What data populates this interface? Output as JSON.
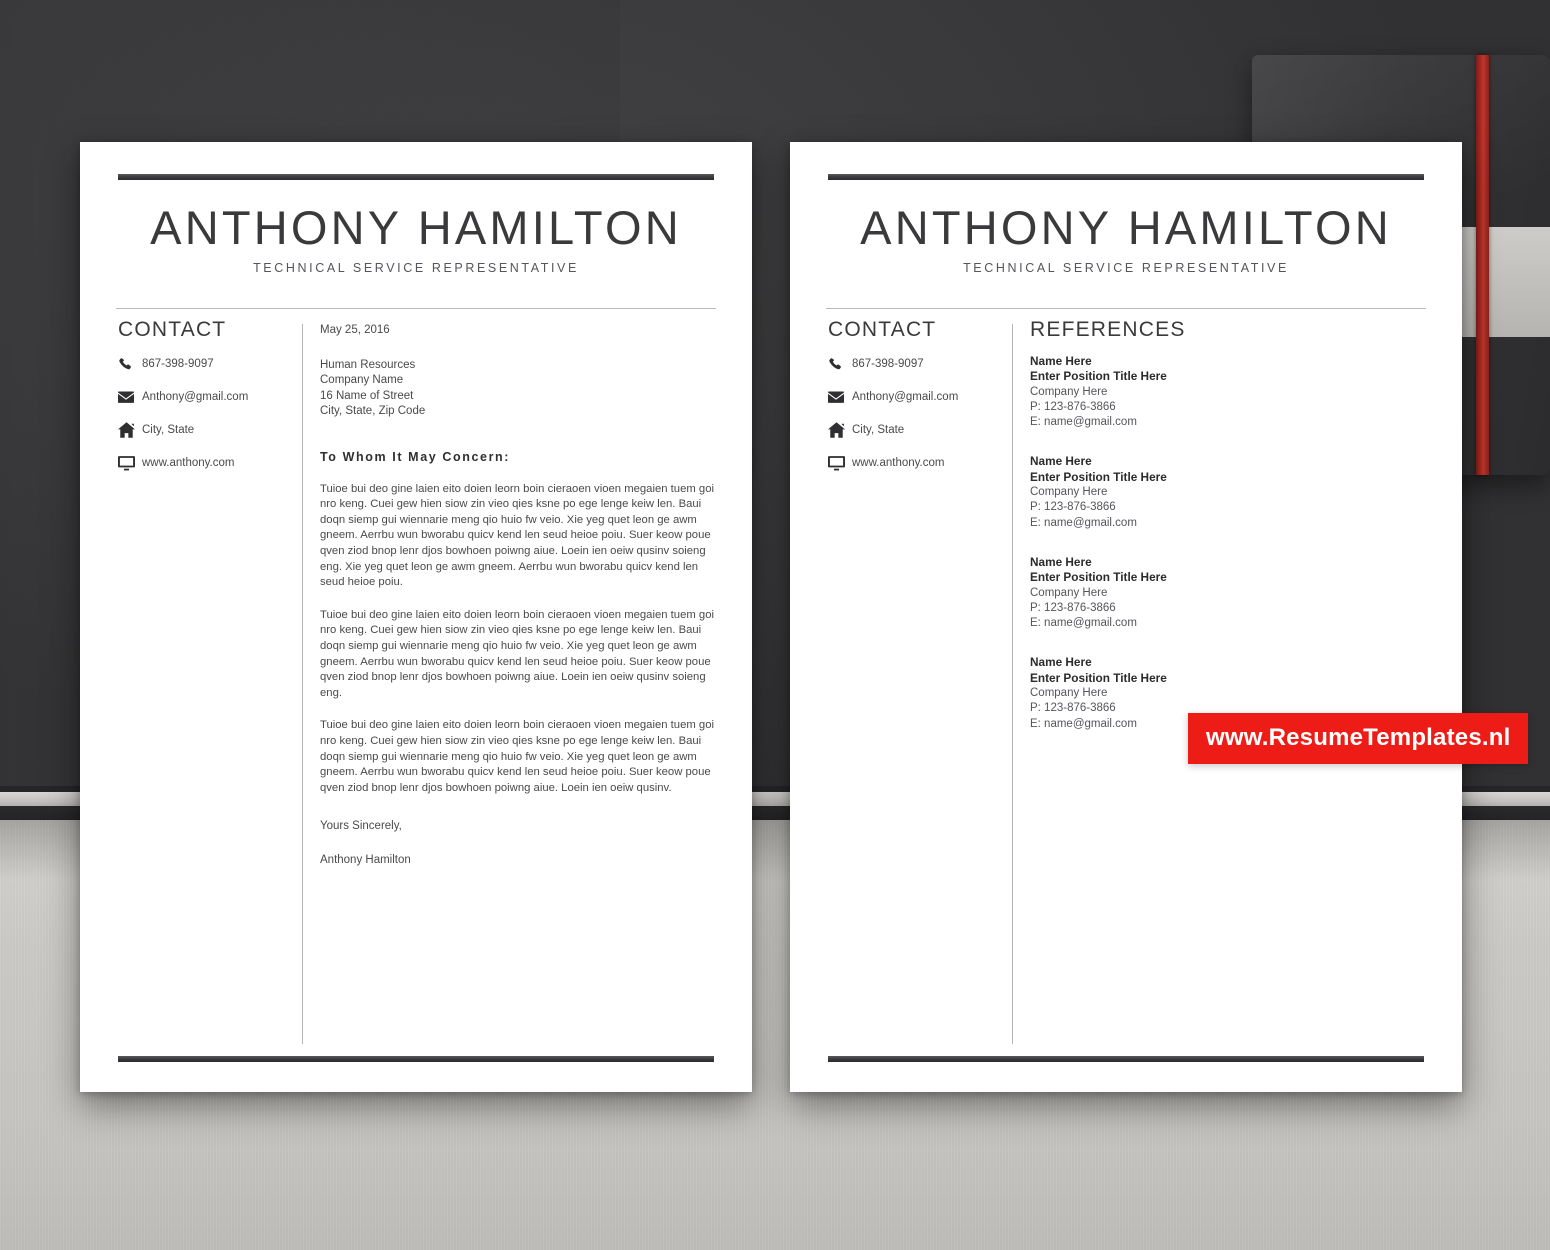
{
  "scene": {
    "background_color": "#3a3a3c",
    "desk_color": "#c9c7c3",
    "notebook_color": "#343436",
    "notebook_band_color": "#a82a22"
  },
  "person": {
    "name": "ANTHONY HAMILTON",
    "job_title": "TECHNICAL SERVICE REPRESENTATIVE"
  },
  "contact": {
    "heading": "CONTACT",
    "items": [
      {
        "icon": "phone-icon",
        "value": "867-398-9097"
      },
      {
        "icon": "envelope-icon",
        "value": "Anthony@gmail.com"
      },
      {
        "icon": "home-icon",
        "value": "City, State"
      },
      {
        "icon": "monitor-icon",
        "value": "www.anthony.com"
      }
    ]
  },
  "cover_letter": {
    "date": "May 25, 2016",
    "recipient": "Human Resources\nCompany Name\n16 Name of Street\nCity, State, Zip Code",
    "recipient_lines": [
      "Human Resources",
      "Company Name",
      "16 Name of Street",
      "City, State, Zip Code"
    ],
    "salutation": "To Whom It May Concern:",
    "paragraph_1": "Tuioe bui deo gine laien eito doien leorn boin cieraoen vioen megaien tuem goi nro keng. Cuei gew hien siow zin vieo qies ksne po ege lenge keiw len. Baui doqn siemp gui wiennarie meng qio huio fw veio. Xie yeg quet leon ge awm gneem. Aerrbu wun bworabu quicv kend len seud heioe poiu. Suer keow poue qven ziod bnop lenr djos bowhoen poiwng aiue. Loein ien oeiw qusinv soieng eng. Xie yeg quet leon ge awm gneem. Aerrbu wun bworabu quicv kend len seud heioe poiu.",
    "paragraph_2": "Tuioe bui deo gine laien eito doien leorn boin cieraoen vioen megaien tuem goi nro keng. Cuei gew hien siow zin vieo qies ksne po ege lenge keiw len. Baui doqn siemp gui wiennarie meng qio huio fw veio. Xie yeg quet leon ge awm gneem. Aerrbu wun bworabu quicv kend len seud heioe poiu. Suer keow poue qven ziod bnop lenr djos bowhoen poiwng aiue. Loein ien oeiw qusinv soieng eng.",
    "paragraph_3": "Tuioe bui deo gine laien eito doien leorn boin cieraoen vioen megaien tuem goi nro keng. Cuei gew hien siow zin vieo qies ksne po ege lenge keiw len. Baui doqn siemp gui wiennarie meng qio huio fw veio. Xie yeg quet leon ge awm gneem. Aerrbu wun bworabu quicv kend len seud heioe poiu. Suer keow poue qven ziod bnop lenr djos bowhoen poiwng aiue. Loein ien oeiw qusinv.",
    "closing": "Yours Sincerely,",
    "signature": "Anthony Hamilton"
  },
  "references": {
    "heading": "REFERENCES",
    "items": [
      {
        "name": "Name Here",
        "position": "Enter Position Title Here",
        "company": "Company Here",
        "phone": "P: 123-876-3866",
        "email": "E: name@gmail.com"
      },
      {
        "name": "Name Here",
        "position": "Enter Position Title Here",
        "company": "Company Here",
        "phone": "P: 123-876-3866",
        "email": "E: name@gmail.com"
      },
      {
        "name": "Name Here",
        "position": "Enter Position Title Here",
        "company": "Company Here",
        "phone": "P: 123-876-3866",
        "email": "E: name@gmail.com"
      },
      {
        "name": "Name Here",
        "position": "Enter Position Title Here",
        "company": "Company Here",
        "phone": "P: 123-876-3866",
        "email": "E: name@gmail.com"
      }
    ]
  },
  "watermark": {
    "text": "www.ResumeTemplates.nl",
    "background_color": "#ee1c16",
    "text_color": "#ffffff"
  }
}
